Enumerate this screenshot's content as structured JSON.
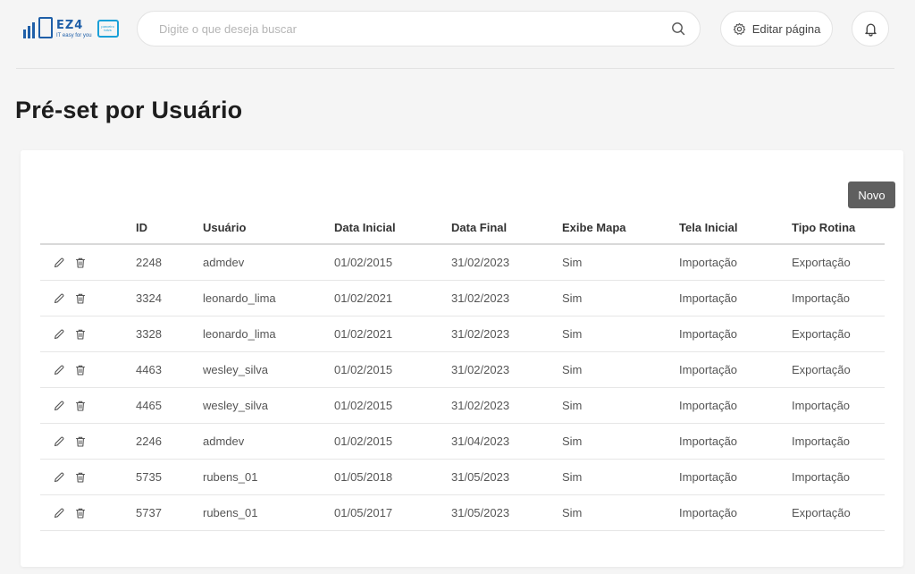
{
  "brand": {
    "logo_text": "EZ4",
    "tagline": "IT easy for you",
    "partner_text": "parceiro totvs",
    "color": "#1f5fa8"
  },
  "search": {
    "placeholder": "Digite o que deseja buscar",
    "value": "",
    "icon": "search-icon"
  },
  "header_actions": {
    "edit_label": "Editar página",
    "edit_icon": "gear-icon",
    "notification_icon": "bell-icon"
  },
  "page": {
    "title": "Pré-set por Usuário"
  },
  "toolbar": {
    "new_label": "Novo",
    "new_color": "#5f5f5f"
  },
  "table": {
    "columns": [
      "ID",
      "Usuário",
      "Data Inicial",
      "Data Final",
      "Exibe Mapa",
      "Tela Inicial",
      "Tipo Rotina"
    ],
    "row_actions": [
      "edit-icon",
      "delete-icon"
    ],
    "rows": [
      [
        "2248",
        "admdev",
        "01/02/2015",
        "31/02/2023",
        "Sim",
        "Importação",
        "Exportação"
      ],
      [
        "3324",
        "leonardo_lima",
        "01/02/2021",
        "31/02/2023",
        "Sim",
        "Importação",
        "Importação"
      ],
      [
        "3328",
        "leonardo_lima",
        "01/02/2021",
        "31/02/2023",
        "Sim",
        "Importação",
        "Exportação"
      ],
      [
        "4463",
        "wesley_silva",
        "01/02/2015",
        "31/02/2023",
        "Sim",
        "Importação",
        "Exportação"
      ],
      [
        "4465",
        "wesley_silva",
        "01/02/2015",
        "31/02/2023",
        "Sim",
        "Importação",
        "Importação"
      ],
      [
        "2246",
        "admdev",
        "01/02/2015",
        "31/04/2023",
        "Sim",
        "Importação",
        "Importação"
      ],
      [
        "5735",
        "rubens_01",
        "01/05/2018",
        "31/05/2023",
        "Sim",
        "Importação",
        "Importação"
      ],
      [
        "5737",
        "rubens_01",
        "01/05/2017",
        "31/05/2023",
        "Sim",
        "Importação",
        "Exportação"
      ]
    ]
  }
}
